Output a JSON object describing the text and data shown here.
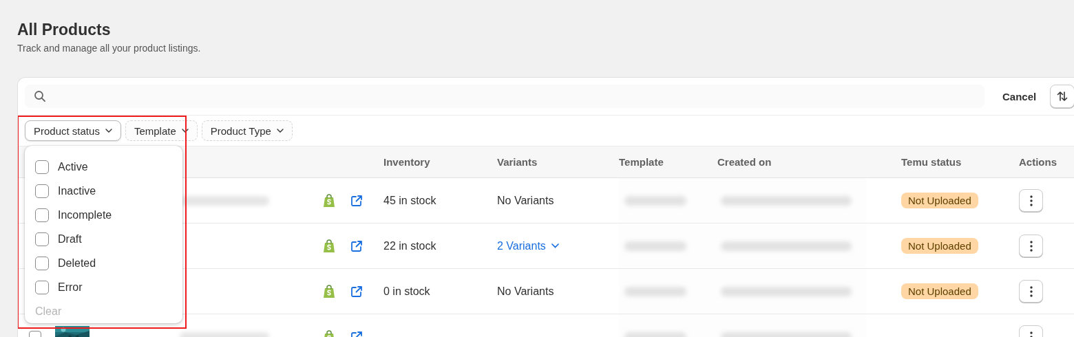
{
  "page": {
    "title": "All Products",
    "subtitle": "Track and manage all your product listings."
  },
  "toolbar": {
    "cancel": "Cancel"
  },
  "filters": [
    {
      "label": "Product status",
      "selected": true
    },
    {
      "label": "Template",
      "selected": false
    },
    {
      "label": "Product Type",
      "selected": false
    }
  ],
  "status_menu": {
    "options": [
      {
        "label": "Active",
        "checked": false
      },
      {
        "label": "Inactive",
        "checked": false
      },
      {
        "label": "Incomplete",
        "checked": false
      },
      {
        "label": "Draft",
        "checked": false
      },
      {
        "label": "Deleted",
        "checked": false
      },
      {
        "label": "Error",
        "checked": false
      }
    ],
    "clear": {
      "label": "Clear",
      "disabled": true
    }
  },
  "table": {
    "columns": [
      "Inventory",
      "Variants",
      "Template",
      "Created on",
      "Temu status",
      "Actions"
    ],
    "rows": [
      {
        "name": {
          "kind": "redacted"
        },
        "inventory": "45 in stock",
        "variants": {
          "kind": "text",
          "label": "No Variants"
        },
        "temu_status": "Not Uploaded"
      },
      {
        "inventory": "22 in stock",
        "variants": {
          "kind": "link",
          "label": "2 Variants"
        },
        "temu_status": "Not Uploaded"
      },
      {
        "inventory": "0 in stock",
        "variants": {
          "kind": "text",
          "label": "No Variants"
        },
        "temu_status": "Not Uploaded"
      },
      {
        "checked": false,
        "name": {
          "kind": "redacted"
        }
      }
    ]
  }
}
